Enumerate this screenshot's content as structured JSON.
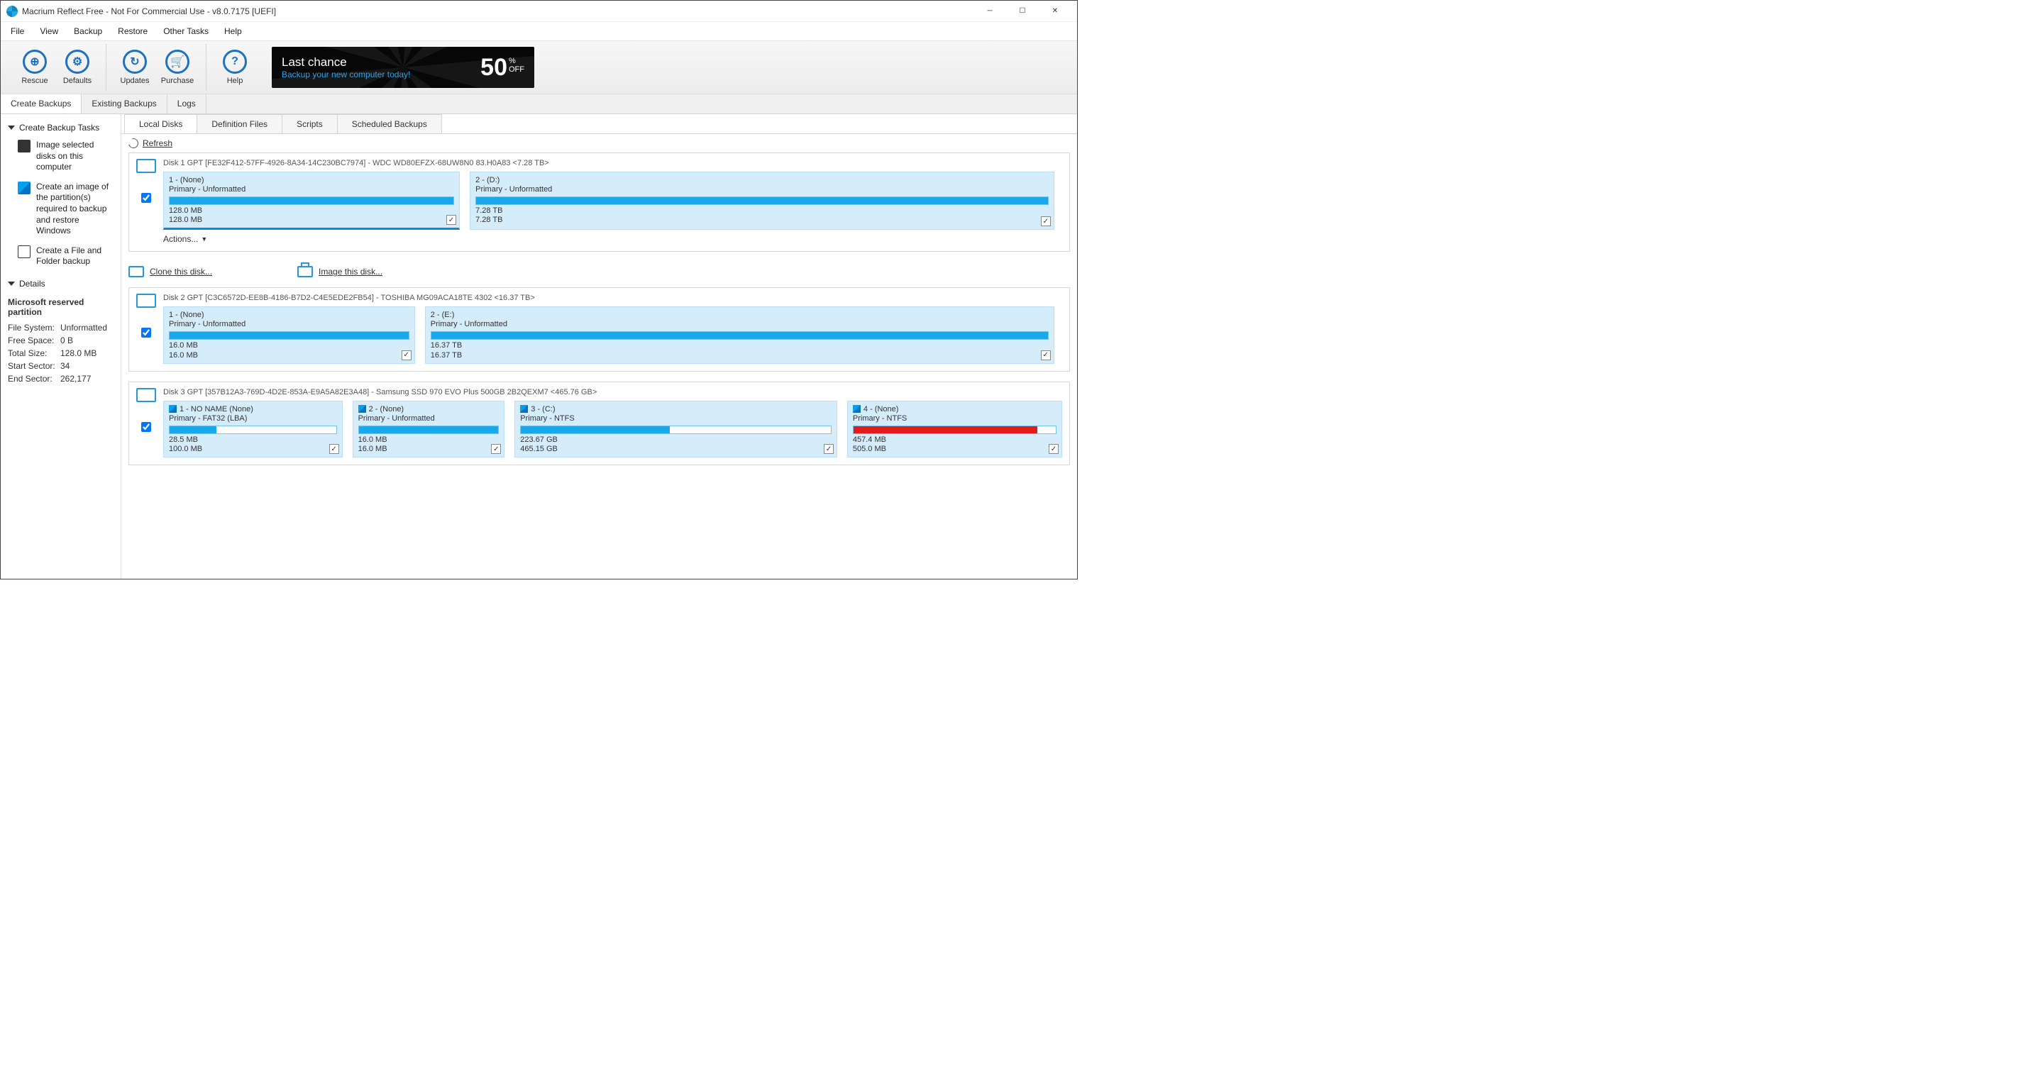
{
  "window": {
    "title": "Macrium Reflect Free - Not For Commercial Use - v8.0.7175  [UEFI]"
  },
  "menu": [
    "File",
    "View",
    "Backup",
    "Restore",
    "Other Tasks",
    "Help"
  ],
  "toolbar": {
    "rescue": "Rescue",
    "defaults": "Defaults",
    "updates": "Updates",
    "purchase": "Purchase",
    "help": "Help"
  },
  "promo": {
    "line1": "Last chance",
    "line2": "Backup your new computer today!",
    "pct": "50",
    "pct_sym": "%",
    "off": "OFF"
  },
  "primaryTabs": {
    "create": "Create Backups",
    "existing": "Existing Backups",
    "logs": "Logs"
  },
  "sidebar": {
    "header": "Create Backup Tasks",
    "task1": "Image selected disks on this computer",
    "task2": "Create an image of the partition(s) required to backup and restore Windows",
    "task3": "Create a File and Folder backup",
    "detailsHeader": "Details",
    "details": {
      "title": "Microsoft reserved partition",
      "fs_k": "File System:",
      "fs_v": "Unformatted",
      "free_k": "Free Space:",
      "free_v": "0 B",
      "total_k": "Total Size:",
      "total_v": "128.0 MB",
      "start_k": "Start Sector:",
      "start_v": "34",
      "end_k": "End Sector:",
      "end_v": "262,177"
    }
  },
  "subtabs": {
    "local": "Local Disks",
    "def": "Definition Files",
    "scripts": "Scripts",
    "sched": "Scheduled Backups"
  },
  "refresh": "Refresh",
  "actions": "Actions...",
  "clone": "Clone this disk...",
  "image": "Image this disk...",
  "disks": [
    {
      "title": "Disk 1 GPT [FE32F412-57FF-4926-8A34-14C230BC7974] - WDC WD80EFZX-68UW8N0 83.H0A83  <7.28 TB>",
      "partitions": [
        {
          "n": "1 -  (None)",
          "t": "Primary - Unformatted",
          "u": "128.0 MB",
          "c": "128.0 MB",
          "fill": 100,
          "w": 33,
          "sel": true,
          "win": false,
          "red": false,
          "chk": true
        },
        {
          "n": "2 -  (D:)",
          "t": "Primary - Unformatted",
          "u": "7.28 TB",
          "c": "7.28 TB",
          "fill": 100,
          "w": 65,
          "sel": false,
          "win": false,
          "red": false,
          "chk": true
        }
      ],
      "showActions": true,
      "showLinks": true
    },
    {
      "title": "Disk 2 GPT [C3C6572D-EE8B-4186-B7D2-C4E5EDE2FB54] - TOSHIBA MG09ACA18TE 4302  <16.37 TB>",
      "partitions": [
        {
          "n": "1 -  (None)",
          "t": "Primary - Unformatted",
          "u": "16.0 MB",
          "c": "16.0 MB",
          "fill": 100,
          "w": 28,
          "sel": false,
          "win": false,
          "red": false,
          "chk": true
        },
        {
          "n": "2 -  (E:)",
          "t": "Primary - Unformatted",
          "u": "16.37 TB",
          "c": "16.37 TB",
          "fill": 100,
          "w": 70,
          "sel": false,
          "win": false,
          "red": false,
          "chk": true
        }
      ],
      "showActions": false,
      "showLinks": false
    },
    {
      "title": "Disk 3 GPT [357B12A3-769D-4D2E-853A-E9A5A82E3A48] - Samsung SSD 970 EVO Plus 500GB 2B2QEXM7  <465.76 GB>",
      "partitions": [
        {
          "n": "1 - NO NAME (None)",
          "t": "Primary - FAT32 (LBA)",
          "u": "28.5 MB",
          "c": "100.0 MB",
          "fill": 28,
          "w": 20,
          "sel": false,
          "win": true,
          "red": false,
          "chk": true
        },
        {
          "n": "2 -  (None)",
          "t": "Primary - Unformatted",
          "u": "16.0 MB",
          "c": "16.0 MB",
          "fill": 100,
          "w": 17,
          "sel": false,
          "win": true,
          "red": false,
          "chk": true
        },
        {
          "n": "3 -  (C:)",
          "t": "Primary - NTFS",
          "u": "223.67 GB",
          "c": "465.15 GB",
          "fill": 48,
          "w": 36,
          "sel": false,
          "win": true,
          "red": false,
          "chk": true
        },
        {
          "n": "4 -  (None)",
          "t": "Primary - NTFS",
          "u": "457.4 MB",
          "c": "505.0 MB",
          "fill": 91,
          "w": 24,
          "sel": false,
          "win": true,
          "red": true,
          "chk": true
        }
      ],
      "showActions": false,
      "showLinks": false
    }
  ]
}
